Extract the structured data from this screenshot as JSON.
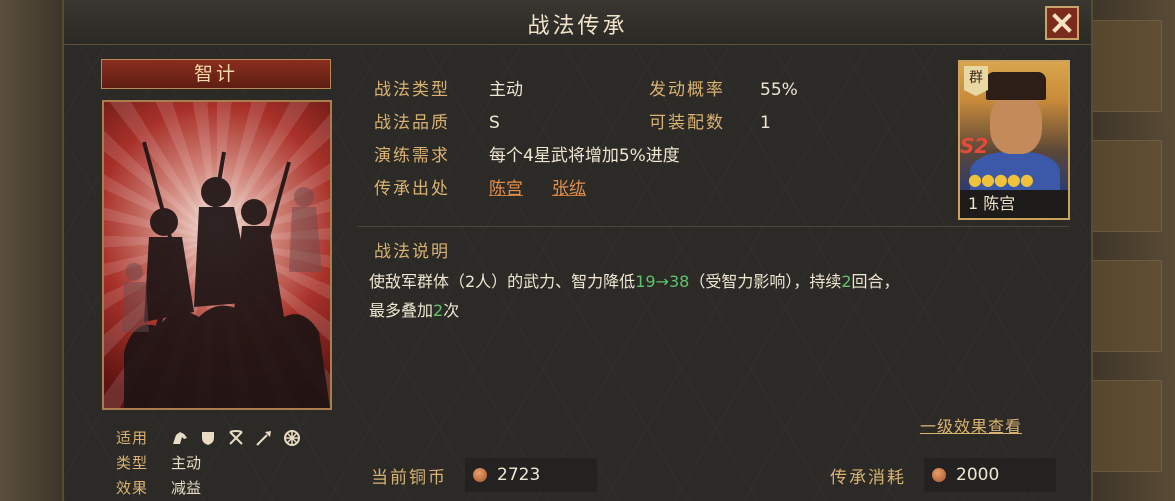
{
  "window": {
    "title": "战法传承",
    "close_icon": "close-icon"
  },
  "card": {
    "category_label": "智计",
    "meta": {
      "applicable_label": "适用",
      "applicable_icons": [
        "cavalry-icon",
        "shield-icon",
        "bow-icon",
        "spear-icon",
        "vehicle-icon"
      ],
      "type_label": "类型",
      "type_value": "主动",
      "effect_label": "效果",
      "effect_value": "减益"
    }
  },
  "info": {
    "tactic_type_label": "战法类型",
    "tactic_type_value": "主动",
    "trigger_rate_label": "发动概率",
    "trigger_rate_value": "55%",
    "quality_label": "战法品质",
    "quality_value": "S",
    "equippable_label": "可装配数",
    "equippable_value": "1",
    "drill_label": "演练需求",
    "drill_value": "每个4星武将增加5%进度",
    "source_label": "传承出处",
    "source_values": [
      "陈宫",
      "张纮"
    ]
  },
  "hero": {
    "faction": "群",
    "season": "S2",
    "stars": 5,
    "level": "1",
    "name": "陈宫"
  },
  "description": {
    "title": "战法说明",
    "text_part1": "使敌军群体（2人）的武力、智力降低",
    "value_from": "19",
    "arrow": "→",
    "value_to": "38",
    "text_part2": "（受智力影响），持续",
    "turns": "2",
    "text_part3": "回合，",
    "text_part4": "最多叠加",
    "stacks": "2",
    "text_part5": "次",
    "level_link": "一级效果查看"
  },
  "footer": {
    "current_coins_label": "当前铜币",
    "current_coins_value": "2723",
    "cost_label": "传承消耗",
    "cost_value": "2000"
  },
  "colors": {
    "accent_gold": "#d9b272",
    "link_orange": "#e5914e",
    "highlight_green": "#5fc36a",
    "close_red": "#7a2b1c"
  }
}
